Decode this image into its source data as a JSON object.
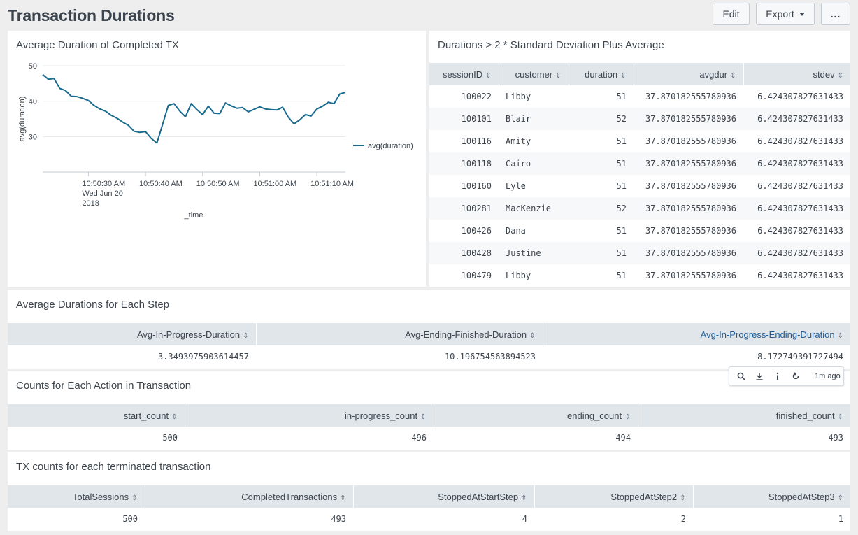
{
  "header": {
    "title": "Transaction Durations",
    "edit_label": "Edit",
    "export_label": "Export",
    "more_label": "..."
  },
  "panels": {
    "avg_duration": {
      "title": "Average Duration of Completed TX"
    },
    "outliers": {
      "title": "Durations > 2 * Standard Deviation Plus Average",
      "columns": [
        "sessionID",
        "customer",
        "duration",
        "avgdur",
        "stdev"
      ],
      "rows": [
        [
          "100022",
          "Libby",
          "51",
          "37.870182555780936",
          "6.424307827631433"
        ],
        [
          "100101",
          "Blair",
          "52",
          "37.870182555780936",
          "6.424307827631433"
        ],
        [
          "100116",
          "Amity",
          "51",
          "37.870182555780936",
          "6.424307827631433"
        ],
        [
          "100118",
          "Cairo",
          "51",
          "37.870182555780936",
          "6.424307827631433"
        ],
        [
          "100160",
          "Lyle",
          "51",
          "37.870182555780936",
          "6.424307827631433"
        ],
        [
          "100281",
          "MacKenzie",
          "52",
          "37.870182555780936",
          "6.424307827631433"
        ],
        [
          "100426",
          "Dana",
          "51",
          "37.870182555780936",
          "6.424307827631433"
        ],
        [
          "100428",
          "Justine",
          "51",
          "37.870182555780936",
          "6.424307827631433"
        ],
        [
          "100479",
          "Libby",
          "51",
          "37.870182555780936",
          "6.424307827631433"
        ]
      ]
    },
    "step_durations": {
      "title": "Average Durations for Each Step",
      "columns": [
        "Avg-In-Progress-Duration",
        "Avg-Ending-Finished-Duration",
        "Avg-In-Progress-Ending-Duration"
      ],
      "row": [
        "3.3493975903614457",
        "10.196754563894523",
        "8.172749391727494"
      ]
    },
    "action_counts": {
      "title": "Counts for Each Action in Transaction",
      "columns": [
        "start_count",
        "in-progress_count",
        "ending_count",
        "finished_count"
      ],
      "row": [
        "500",
        "496",
        "494",
        "493"
      ]
    },
    "tx_counts": {
      "title": "TX counts for each terminated transaction",
      "columns": [
        "TotalSessions",
        "CompletedTransactions",
        "StoppedAtStartStep",
        "StoppedAtStep2",
        "StoppedAtStep3"
      ],
      "row": [
        "500",
        "493",
        "4",
        "2",
        "1"
      ]
    }
  },
  "toolbar": {
    "time_ago": "1m ago",
    "icons": [
      "search-icon",
      "download-icon",
      "info-icon",
      "refresh-icon"
    ]
  },
  "colors": {
    "series_line": "#1a6a8e",
    "header_bg": "#e1e6eb",
    "link": "#1e5d99"
  },
  "chart_data": {
    "type": "line",
    "title": "Average Duration of Completed TX",
    "xlabel": "_time",
    "ylabel": "avg(duration)",
    "ylim": [
      20,
      50
    ],
    "yticks": [
      30,
      40,
      50
    ],
    "xticks": [
      {
        "t": 8,
        "label": [
          "10:50:30 AM",
          "Wed Jun 20",
          "2018"
        ]
      },
      {
        "t": 18,
        "label": [
          "10:50:40 AM"
        ]
      },
      {
        "t": 28,
        "label": [
          "10:50:50 AM"
        ]
      },
      {
        "t": 38,
        "label": [
          "10:51:00 AM"
        ]
      },
      {
        "t": 48,
        "label": [
          "10:51:10 AM"
        ]
      }
    ],
    "grid": true,
    "legend": "right",
    "series": [
      {
        "name": "avg(duration)",
        "x": [
          0,
          1,
          2,
          3,
          4,
          5,
          6,
          7,
          8,
          9,
          10,
          11,
          12,
          13,
          14,
          15,
          16,
          17,
          18,
          19,
          20,
          21,
          22,
          23,
          24,
          25,
          26,
          27,
          28,
          29,
          30,
          31,
          32,
          33,
          34,
          35,
          36,
          37,
          38,
          39,
          40,
          41,
          42,
          43,
          44,
          45,
          46,
          47,
          48,
          49,
          50,
          51,
          52,
          53
        ],
        "values": [
          47.5,
          46.2,
          46.4,
          43.6,
          43.0,
          41.4,
          41.3,
          40.8,
          40.2,
          38.8,
          37.8,
          37.2,
          36.0,
          35.2,
          34.1,
          33.2,
          31.5,
          31.2,
          31.4,
          29.5,
          28.2,
          33.5,
          38.8,
          39.3,
          37.2,
          35.6,
          39.3,
          37.6,
          36.2,
          38.6,
          36.6,
          36.5,
          39.5,
          38.7,
          38.0,
          38.2,
          37.0,
          37.7,
          38.4,
          37.8,
          37.6,
          37.5,
          38.3,
          35.5,
          33.6,
          34.7,
          36.2,
          35.8,
          37.8,
          38.6,
          39.7,
          39.3,
          42.0,
          42.5
        ]
      }
    ]
  }
}
